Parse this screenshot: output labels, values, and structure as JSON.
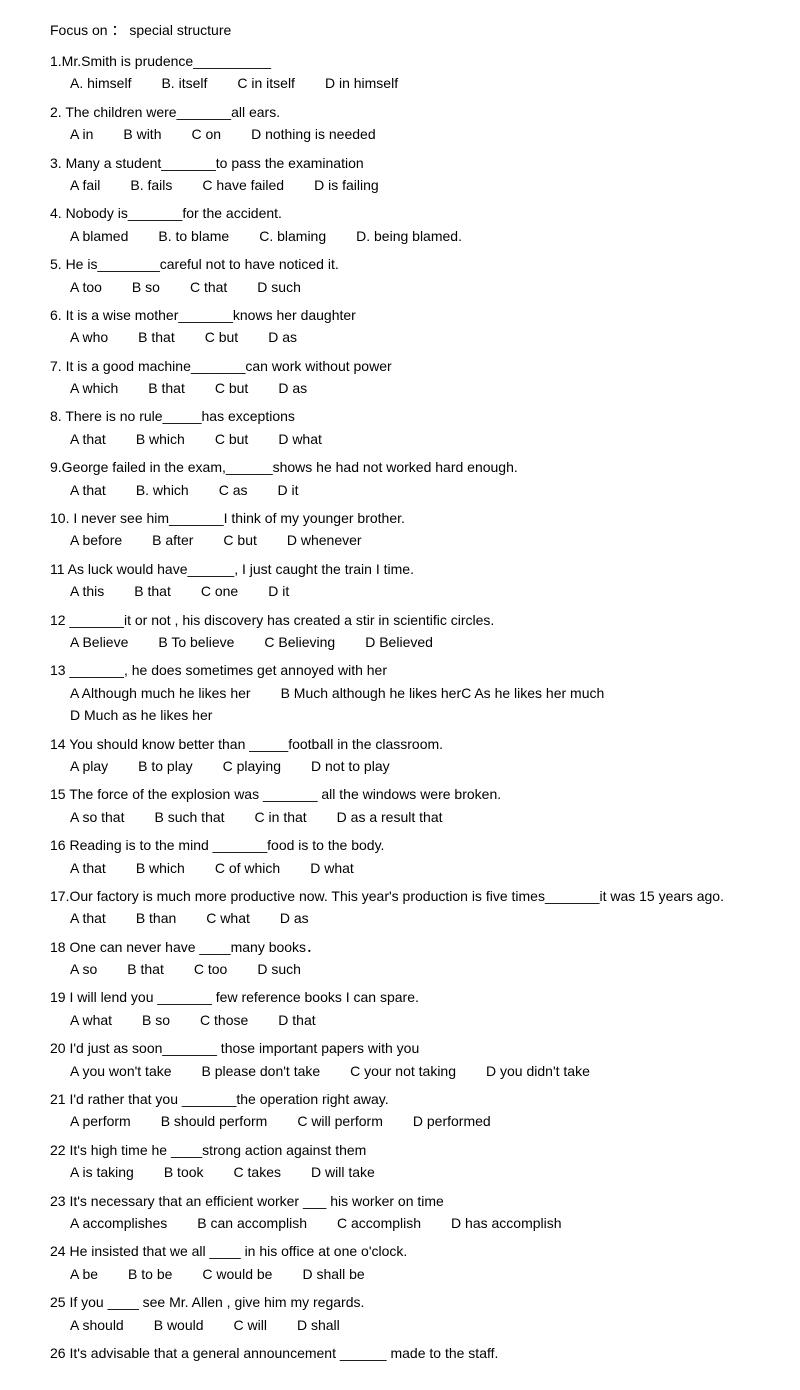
{
  "header": {
    "line1": "Focus on ：    special structure"
  },
  "questions": [
    {
      "id": "q1",
      "text": "1.Mr.Smith is prudence__________",
      "options": [
        "A. himself",
        "B. itself",
        "C in itself",
        "D in himself"
      ]
    },
    {
      "id": "q2",
      "text": "2. The children were_______all ears.",
      "options": [
        "A in",
        "B with",
        "C on",
        "D nothing is needed"
      ]
    },
    {
      "id": "q3",
      "text": "3. Many a student_______to pass the examination",
      "options": [
        "A fail",
        "B. fails",
        "C have failed",
        "D is failing"
      ]
    },
    {
      "id": "q4",
      "text": "4. Nobody is_______for the accident.",
      "options": [
        "A blamed",
        "B. to blame",
        "C. blaming",
        "D.  being blamed."
      ]
    },
    {
      "id": "q5",
      "text": "5. He is________careful not to have noticed it.",
      "options": [
        "A   too",
        "B so",
        "C that",
        "D such"
      ]
    },
    {
      "id": "q6",
      "text": "6. It is a wise mother_______knows her daughter",
      "options": [
        "A who",
        "B  that",
        "C but",
        "D as"
      ]
    },
    {
      "id": "q7",
      "text": "7. It is a good machine_______can work without power",
      "options": [
        "A which",
        "B that",
        "C but",
        "D as"
      ]
    },
    {
      "id": "q8",
      "text": "8. There is no rule_____has exceptions",
      "options": [
        "A that",
        "B which",
        "C but",
        "D what"
      ]
    },
    {
      "id": "q9",
      "text": "9.George failed in the exam,______shows he had not worked hard enough.",
      "options": [
        "A that",
        "B. which",
        "C as",
        "D it"
      ]
    },
    {
      "id": "q10",
      "text": "10. I never see him_______I think of my younger brother.",
      "options": [
        "A before",
        "B after",
        "C but",
        "D whenever"
      ]
    },
    {
      "id": "q11",
      "text": "11 As luck would have______, I just caught the train I time.",
      "options": [
        "A this",
        "B that",
        "C one",
        "D it"
      ]
    },
    {
      "id": "q12",
      "text": "12 _______it or not , his discovery has created a stir in scientific circles.",
      "options": [
        "A Believe",
        "B To believe",
        "C Believing",
        "D Believed"
      ]
    },
    {
      "id": "q13",
      "text": "13 _______, he does sometimes get annoyed with her",
      "options": [
        "A Although much he likes her",
        "B Much although he likes herC As he likes her much",
        "D Much as he likes her"
      ]
    },
    {
      "id": "q14",
      "text": "14 You should know better than  _____football in the classroom.",
      "options": [
        "A   play",
        "B to play",
        "C playing",
        "D not to play"
      ]
    },
    {
      "id": "q15",
      "text": "15 The force of the explosion was  _______ all the windows were broken.",
      "options": [
        "A   so that",
        "B such that",
        "C in that",
        "D as a result that"
      ]
    },
    {
      "id": "q16",
      "text": "16 Reading is to the mind  _______food is to the body.",
      "options": [
        "A that",
        "B which",
        "C of which",
        "D what"
      ]
    },
    {
      "id": "q17",
      "text": "17.Our factory is much more productive now. This year's production is five times_______it was 15 years ago.",
      "options": [
        "A that",
        "B than",
        "C what",
        "D as"
      ]
    },
    {
      "id": "q18",
      "text": "18 One can never have ____many books．",
      "options": [
        "A so",
        "B that",
        "C too",
        "D such"
      ]
    },
    {
      "id": "q19",
      "text": "19 I will lend you  _______ few reference books I can spare.",
      "options": [
        "A what",
        "B so",
        "C those",
        "D that"
      ]
    },
    {
      "id": "q20",
      "text": "20 I'd just as soon_______ those important papers with you",
      "options": [
        "A you won't take",
        "B please don't take",
        "C your not taking",
        "D you didn't take"
      ]
    },
    {
      "id": "q21",
      "text": "21 I'd rather that you  _______the operation right away.",
      "options": [
        "A perform",
        "B should perform",
        "C will perform",
        "D performed"
      ]
    },
    {
      "id": "q22",
      "text": "22 It's high time he  ____strong action against them",
      "options": [
        "A is taking",
        "B took",
        "C takes",
        "D will take"
      ]
    },
    {
      "id": "q23",
      "text": "23 It's necessary that an efficient worker  ___  his worker on time",
      "options": [
        "A accomplishes",
        "B can accomplish",
        "C accomplish",
        "D has accomplish"
      ]
    },
    {
      "id": "q24",
      "text": "24 He insisted that we all  ____  in his office at one o'clock.",
      "options": [
        "A be",
        "B to be",
        "C would be",
        "D shall be"
      ]
    },
    {
      "id": "q25",
      "text": "25 If you  ____  see Mr. Allen , give him my regards.",
      "options": [
        "A should",
        "B would",
        "C will",
        "D shall"
      ]
    },
    {
      "id": "q26",
      "text": "26 It's advisable that a general announcement  ______  made to the staff.",
      "options": []
    }
  ]
}
